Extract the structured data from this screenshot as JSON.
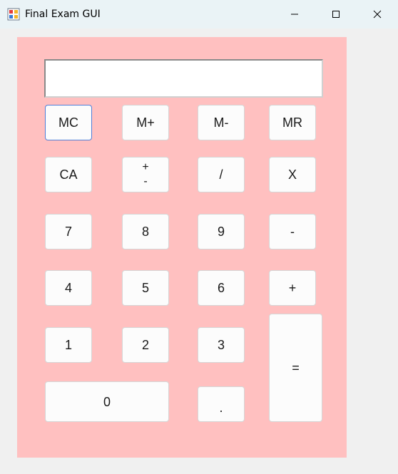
{
  "window": {
    "title": "Final Exam GUI",
    "controls": {
      "minimize": "minimize",
      "maximize": "maximize",
      "close": "close"
    }
  },
  "calculator": {
    "display_value": "",
    "buttons": {
      "mc": "MC",
      "m_plus": "M+",
      "m_minus": "M-",
      "mr": "MR",
      "ca": "CA",
      "plus_minus": "+\n-",
      "divide": "/",
      "multiply": "X",
      "seven": "7",
      "eight": "8",
      "nine": "9",
      "subtract": "-",
      "four": "4",
      "five": "5",
      "six": "6",
      "add": "+",
      "one": "1",
      "two": "2",
      "three": "3",
      "equals": "=",
      "zero": "0",
      "decimal": "."
    }
  },
  "colors": {
    "panel_background": "#ffc0c0",
    "button_background": "#fcfcfc",
    "focus_border": "#4f7fd8"
  }
}
